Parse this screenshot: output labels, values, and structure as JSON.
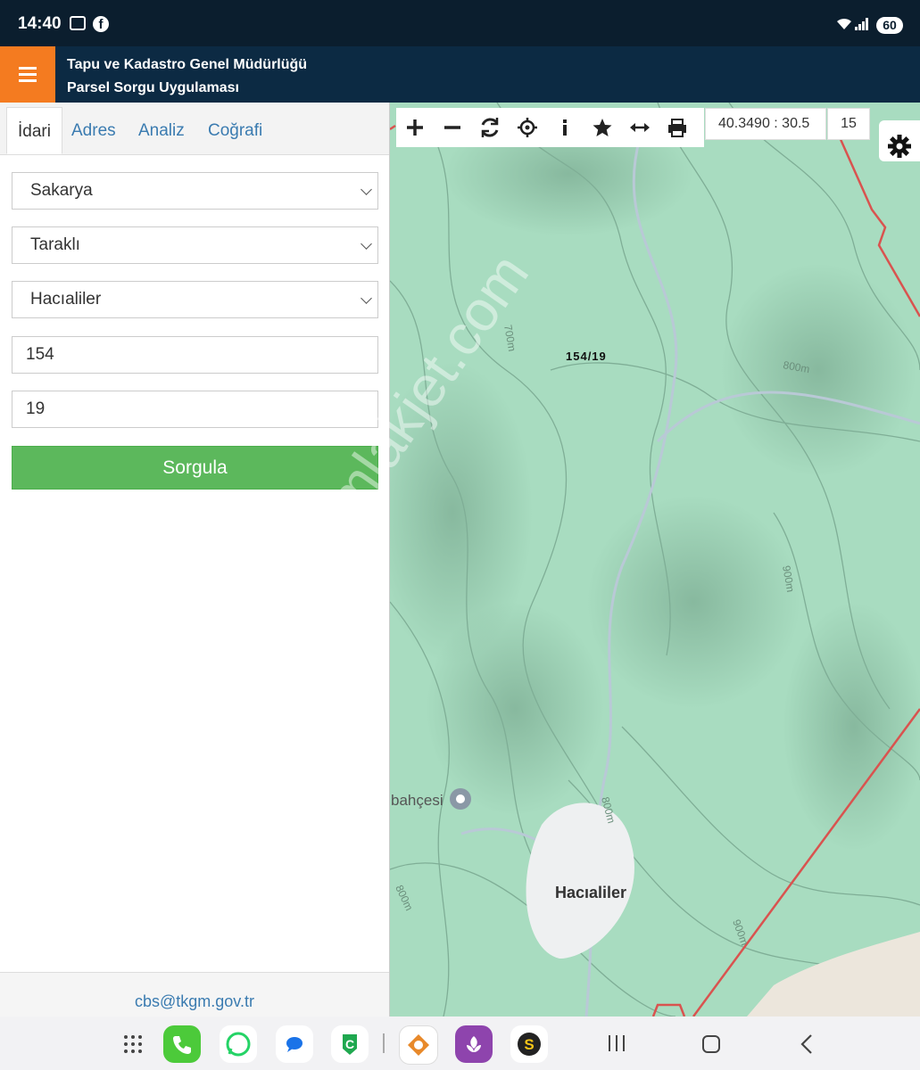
{
  "status": {
    "time": "14:40",
    "battery": "60"
  },
  "header": {
    "title_line1": "Tapu ve Kadastro Genel Müdürlüğü",
    "title_line2": "Parsel Sorgu Uygulaması"
  },
  "tabs": [
    {
      "label": "İdari",
      "active": true
    },
    {
      "label": "Adres"
    },
    {
      "label": "Analiz"
    },
    {
      "label": "Coğrafi"
    }
  ],
  "form": {
    "province": "Sakarya",
    "district": "Taraklı",
    "neighborhood": "Hacıaliler",
    "block": "154",
    "parcel": "19",
    "query_label": "Sorgula"
  },
  "footer": {
    "email": "cbs@tkgm.gov.tr"
  },
  "map": {
    "coordinates": "40.3490 : 30.5",
    "zoom": "15",
    "parcel_label": "154/19",
    "poi_label": "bahçesi",
    "village_label": "Hacıaliler",
    "contour_labels": [
      "700m",
      "800m",
      "900m",
      "800m",
      "800m",
      "900m"
    ],
    "watermark": "emlakjet.com"
  },
  "colors": {
    "header_bg": "#0c2a43",
    "menu_accent": "#f47b20",
    "query_button": "#5cb85c",
    "link": "#3a7bb0",
    "map_forest": "#a8dcc0",
    "boundary_line": "#d9534f"
  }
}
